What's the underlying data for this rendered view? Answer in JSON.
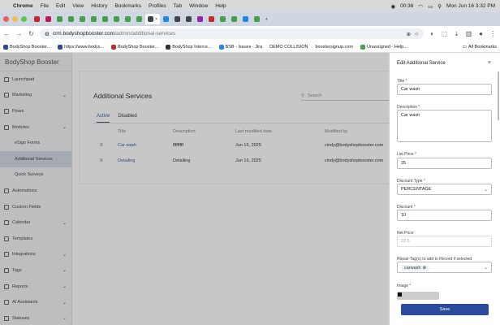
{
  "os_menubar": {
    "app": "Chrome",
    "items": [
      "File",
      "Edit",
      "View",
      "History",
      "Bookmarks",
      "Profiles",
      "Tab",
      "Window",
      "Help"
    ],
    "timer": "00:36",
    "datetime": "Mon Jun 16  3:32 PM"
  },
  "browser": {
    "active_tab_label": "",
    "url_host": "crm.bodyshopbooster.com",
    "url_path": "/admin/additional-services",
    "bookmarks": [
      "BodyShop Booster...",
      "https://www.bodys...",
      "BodyShop Booster...",
      "BodyShop Interce...",
      "BSB - Issues - Jira",
      "DEMO COLLISION",
      "boostersignup.com",
      "Unassigned - Help..."
    ],
    "all_bookmarks_label": "All Bookmarks"
  },
  "app": {
    "brand": "BodyShop Booster",
    "nav": [
      {
        "label": "Launchpad",
        "chevron": false,
        "sub": false,
        "active": false
      },
      {
        "label": "Marketing",
        "chevron": true,
        "sub": false,
        "active": false
      },
      {
        "label": "Flows",
        "chevron": false,
        "sub": false,
        "active": false
      },
      {
        "label": "Modules",
        "chevron": true,
        "sub": false,
        "active": false
      },
      {
        "label": "eSign Forms",
        "chevron": false,
        "sub": true,
        "active": false
      },
      {
        "label": "Additional Services",
        "chevron": false,
        "sub": true,
        "active": true
      },
      {
        "label": "Quick Surveys",
        "chevron": false,
        "sub": true,
        "active": false
      },
      {
        "label": "Automations",
        "chevron": false,
        "sub": false,
        "active": false
      },
      {
        "label": "Custom Fields",
        "chevron": false,
        "sub": false,
        "active": false
      },
      {
        "label": "Calendar",
        "chevron": true,
        "sub": false,
        "active": false
      },
      {
        "label": "Templates",
        "chevron": false,
        "sub": false,
        "active": false
      },
      {
        "label": "Integrations",
        "chevron": true,
        "sub": false,
        "active": false
      },
      {
        "label": "Tags",
        "chevron": true,
        "sub": false,
        "active": false
      },
      {
        "label": "Reports",
        "chevron": true,
        "sub": false,
        "active": false
      },
      {
        "label": "AI Assistants",
        "chevron": true,
        "sub": false,
        "active": false
      },
      {
        "label": "Statuses",
        "chevron": true,
        "sub": false,
        "active": false
      }
    ],
    "page_title": "Additional Services",
    "search_placeholder": "Search",
    "tabs": [
      {
        "label": "Active",
        "active": true
      },
      {
        "label": "Disabled",
        "active": false
      }
    ],
    "table": {
      "headers": [
        "Title",
        "Description",
        "Last modified date",
        "Modified by"
      ],
      "rows": [
        [
          "Car wash",
          "fffffffff",
          "Jun 16, 2025",
          "cindy@bodyshopbooster.com"
        ],
        [
          "Detailing",
          "Detailing",
          "Jun 16, 2025",
          "cindy@bodyshopbooster.com"
        ]
      ]
    }
  },
  "drawer": {
    "title": "Edit Additional Service",
    "close_icon": "×",
    "fields": {
      "title": {
        "label": "Title",
        "value": "Car wash"
      },
      "description": {
        "label": "Description",
        "value": "Car wash"
      },
      "list_price": {
        "label": "List Price",
        "value": "25"
      },
      "discount_type": {
        "label": "Discount Type",
        "value": "PERCENTAGE"
      },
      "discount": {
        "label": "Discount",
        "value": "10"
      },
      "net_price": {
        "label": "Net Price",
        "value": "22.5"
      },
      "repair_tags": {
        "label": "Repair Tag(s) to add to Record if selected",
        "chip": "carwash"
      },
      "image": {
        "label": "Image"
      }
    },
    "save_label": "Save"
  },
  "colors": {
    "accent": "#2b4a9b",
    "required": "#c62828",
    "tabstrip": "#cfd7e3"
  }
}
